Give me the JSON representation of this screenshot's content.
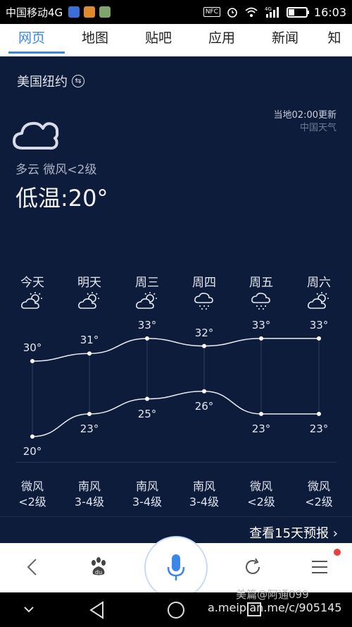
{
  "status_bar": {
    "carrier": "中国移动4G",
    "network": "4G",
    "time": "16:03",
    "battery_level": 0.35
  },
  "tabs": [
    {
      "label": "网页",
      "active": true
    },
    {
      "label": "地图",
      "active": false
    },
    {
      "label": "贴吧",
      "active": false
    },
    {
      "label": "应用",
      "active": false
    },
    {
      "label": "新闻",
      "active": false
    },
    {
      "label": "知",
      "active": false
    }
  ],
  "weather": {
    "location": "美国纽约",
    "update_time": "当地02:00更新",
    "source": "中国天气",
    "condition": "多云  微风<2级",
    "low_temp": "低温:20°",
    "more_link": "查看15天预报",
    "days": [
      {
        "name": "今天",
        "icon": "partly-cloudy-icon",
        "high": 30,
        "low": 20,
        "high_label": "30°",
        "low_label": "20°",
        "wind_dir": "微风",
        "wind_level": "<2级"
      },
      {
        "name": "明天",
        "icon": "partly-cloudy-icon",
        "high": 31,
        "low": 23,
        "high_label": "31°",
        "low_label": "23°",
        "wind_dir": "南风",
        "wind_level": "3-4级"
      },
      {
        "name": "周三",
        "icon": "partly-cloudy-icon",
        "high": 33,
        "low": 25,
        "high_label": "33°",
        "low_label": "25°",
        "wind_dir": "南风",
        "wind_level": "3-4级"
      },
      {
        "name": "周四",
        "icon": "rain-cloud-icon",
        "high": 32,
        "low": 26,
        "high_label": "32°",
        "low_label": "26°",
        "wind_dir": "南风",
        "wind_level": "3-4级"
      },
      {
        "name": "周五",
        "icon": "rain-cloud-icon",
        "high": 33,
        "low": 23,
        "high_label": "33°",
        "low_label": "23°",
        "wind_dir": "微风",
        "wind_level": "<2级"
      },
      {
        "name": "周六",
        "icon": "partly-cloudy-icon",
        "high": 33,
        "low": 23,
        "high_label": "33°",
        "low_label": "23°",
        "wind_dir": "微风",
        "wind_level": "<2级"
      }
    ]
  },
  "toolbar": {
    "items": [
      "back-icon",
      "baidu-paw-icon",
      "microphone-icon",
      "refresh-icon",
      "menu-icon"
    ]
  },
  "watermark": {
    "line1": "美篇@阿通099",
    "line2": "a.meipian.me/c/905145"
  },
  "colors": {
    "accent": "#3b86e6",
    "background": "#0e1c3b",
    "notification": "#e94040"
  }
}
